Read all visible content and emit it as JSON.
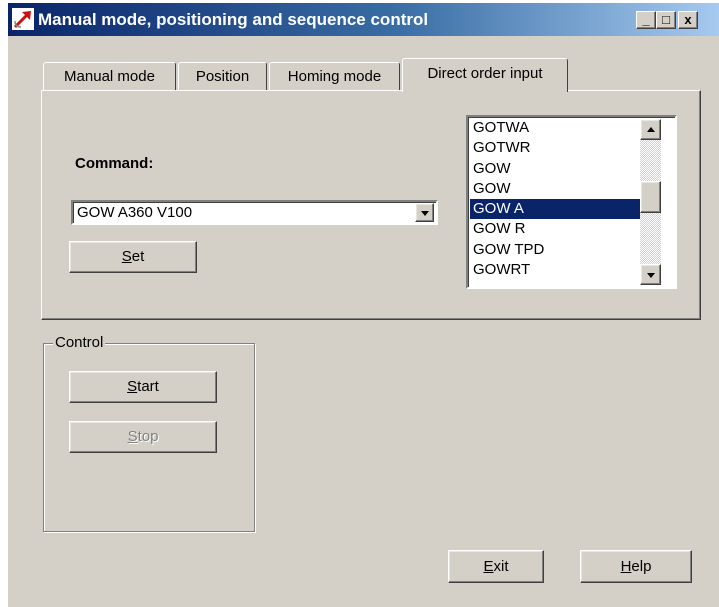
{
  "window": {
    "title": "Manual mode, positioning and sequence control",
    "controls": {
      "minimize": "_",
      "maximize": "□",
      "close": "x"
    },
    "colors": {
      "titlebar_start": "#0a246a",
      "titlebar_end": "#a6caf0",
      "face": "#d4d0c8",
      "selection": "#0a246a"
    }
  },
  "tabs": [
    {
      "label": "Manual mode",
      "active": false
    },
    {
      "label": "Position",
      "active": false
    },
    {
      "label": "Homing mode",
      "active": false
    },
    {
      "label": "Direct order input",
      "active": true
    }
  ],
  "direct_order": {
    "command_label": "Command:",
    "command_value": "GOW A360 V100",
    "set_button": "Set",
    "set_mnemonic": "S",
    "set_rest": "et",
    "list_items": [
      "GOTWA",
      "GOTWR",
      "GOW",
      "GOW",
      "GOW A",
      "GOW R",
      "GOW TPD",
      "GOWRT"
    ],
    "selected_item": "GOW A"
  },
  "control_group": {
    "label": "Control",
    "start_mnemonic": "S",
    "start_rest": "tart",
    "stop_mnemonic": "S",
    "stop_rest": "top",
    "stop_enabled": false
  },
  "footer": {
    "exit_mnemonic": "E",
    "exit_rest": "xit",
    "help_mnemonic": "H",
    "help_rest": "elp"
  },
  "icons": {
    "app": "app-arrow-icon",
    "dropdown": "chevron-down-icon",
    "scroll_up": "scroll-up-icon",
    "scroll_down": "scroll-down-icon"
  }
}
